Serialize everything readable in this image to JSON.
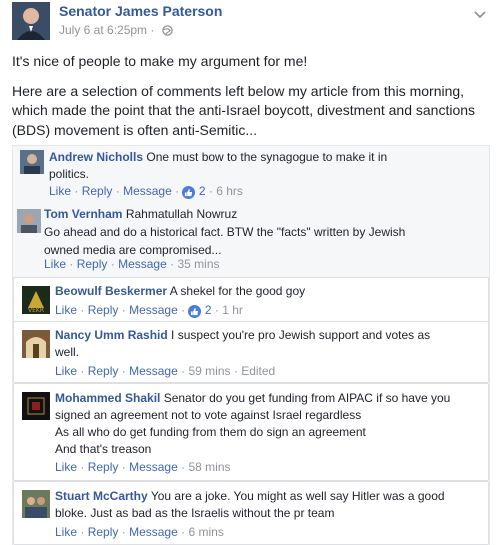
{
  "post": {
    "author": "Senator James Paterson",
    "timestamp": "July 6 at 6:25pm",
    "separator": "·",
    "paragraph1": "It's nice of people to make my argument for me!",
    "paragraph2": "Here are a selection of comments left below my article from this morning, which made the point that the anti-Israel boycott, divestment and sanctions (BDS) movement is often anti-Semitic..."
  },
  "labels": {
    "like": "Like",
    "reply": "Reply",
    "message": "Message",
    "dot": "·",
    "edited": "Edited"
  },
  "comments": [
    {
      "name": "Andrew Nicholls",
      "text": "One must bow to the synagogue to make it in politics.",
      "reactions": "2",
      "time": "6 hrs"
    },
    {
      "name": "Tom Vernham",
      "text_line1": "Rahmatullah Nowruz",
      "text_rest": "Go ahead and do a historical fact. BTW the \"facts\" written by Jewish owned media are compromised...",
      "time": "35 mins"
    },
    {
      "name": "Beowulf Beskermer",
      "text": "A shekel for the good goy",
      "reactions": "2",
      "time": "1 hr"
    },
    {
      "name": "Nancy Umm Rashid",
      "text": "I suspect you're pro Jewish support and votes as well.",
      "time": "59 mins"
    },
    {
      "name": "Mohammed Shakil",
      "text": "Senator do you get funding from AIPAC if so have you signed an agreement not to vote against Israel regardless",
      "line2": "As all who do get funding from them do sign an agreement",
      "line3": "And that's treason",
      "time": "58 mins"
    },
    {
      "name": "Stuart McCarthy",
      "text": "You are a joke. You might as well say Hitler was a good bloke. Just as bad as the Israelis without the pr team",
      "time": "6 mins"
    }
  ],
  "colors": {
    "name": "#365899",
    "link": "#4267b2",
    "meta": "#90949c",
    "reaction": "#4a7ddb"
  },
  "icons": {
    "globe": "globe-icon",
    "chevron": "chevron-down-icon",
    "like_reaction": "like-reaction-icon"
  }
}
